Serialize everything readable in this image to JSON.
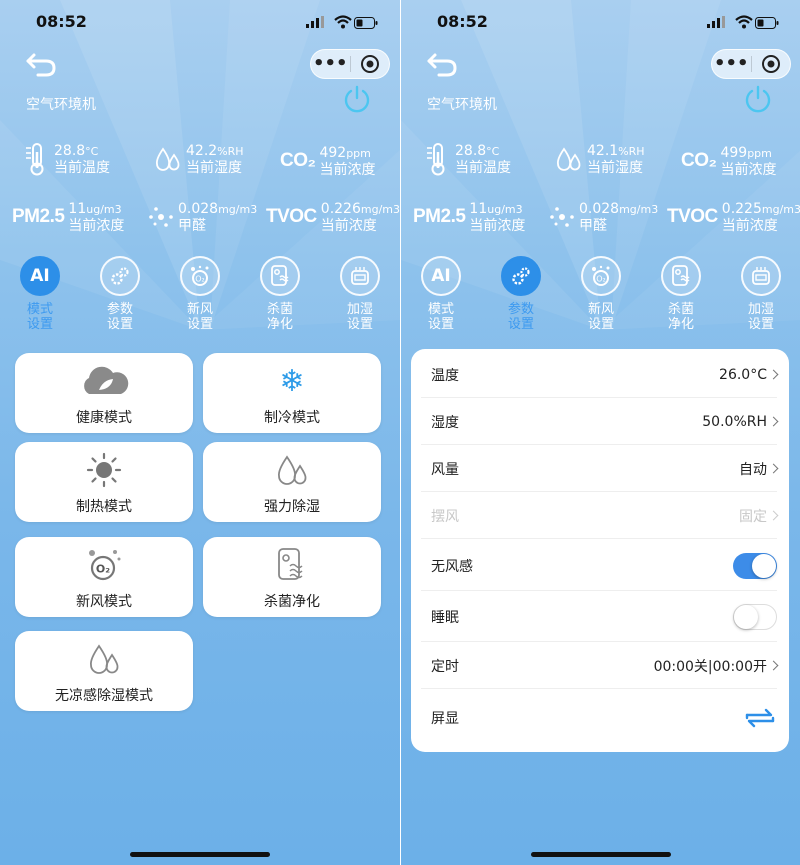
{
  "status": {
    "time": "08:52"
  },
  "device": {
    "name": "空气环境机"
  },
  "left": {
    "metrics": {
      "temp": {
        "value": "28.8",
        "unit": "°C",
        "label": "当前温度"
      },
      "humidity": {
        "value": "42.2",
        "unit": "%RH",
        "label": "当前湿度"
      },
      "co2": {
        "icon": "CO₂",
        "value": "492",
        "unit": "ppm",
        "label": "当前浓度"
      },
      "pm25": {
        "icon": "PM2.5",
        "value": "11",
        "unit": "ug/m3",
        "label": "当前浓度"
      },
      "formaldehyde": {
        "value": "0.028",
        "unit": "mg/m3",
        "label": "甲醛"
      },
      "tvoc": {
        "icon": "TVOC",
        "value": "0.226",
        "unit": "mg/m3",
        "label": "当前浓度"
      }
    },
    "modes": [
      "健康模式",
      "制冷模式",
      "制热模式",
      "强力除湿",
      "新风模式",
      "杀菌净化",
      "无凉感除湿模式"
    ]
  },
  "right": {
    "metrics": {
      "temp": {
        "value": "28.8",
        "unit": "°C",
        "label": "当前温度"
      },
      "humidity": {
        "value": "42.1",
        "unit": "%RH",
        "label": "当前湿度"
      },
      "co2": {
        "icon": "CO₂",
        "value": "499",
        "unit": "ppm",
        "label": "当前浓度"
      },
      "pm25": {
        "icon": "PM2.5",
        "value": "11",
        "unit": "ug/m3",
        "label": "当前浓度"
      },
      "formaldehyde": {
        "value": "0.028",
        "unit": "mg/m3",
        "label": "甲醛"
      },
      "tvoc": {
        "icon": "TVOC",
        "value": "0.225",
        "unit": "mg/m3",
        "label": "当前浓度"
      }
    },
    "settings": [
      {
        "label": "温度",
        "value": "26.0°C"
      },
      {
        "label": "湿度",
        "value": "50.0%RH"
      },
      {
        "label": "风量",
        "value": "自动"
      },
      {
        "label": "摆风",
        "value": "固定"
      },
      {
        "label": "无风感",
        "state": "on"
      },
      {
        "label": "睡眠",
        "state": "off"
      },
      {
        "label": "定时",
        "value": "00:00关|00:00开"
      },
      {
        "label": "屏显"
      }
    ]
  },
  "tabs": [
    {
      "icon": "AI",
      "line1": "模式",
      "line2": "设置"
    },
    {
      "line1": "参数",
      "line2": "设置"
    },
    {
      "line1": "新风",
      "line2": "设置"
    },
    {
      "line1": "杀菌",
      "line2": "净化"
    },
    {
      "line1": "加湿",
      "line2": "设置"
    }
  ],
  "colors": {
    "accent": "#2d8fe8",
    "power": "#4cc6f0",
    "toggle_on": "#3d8ce8"
  }
}
